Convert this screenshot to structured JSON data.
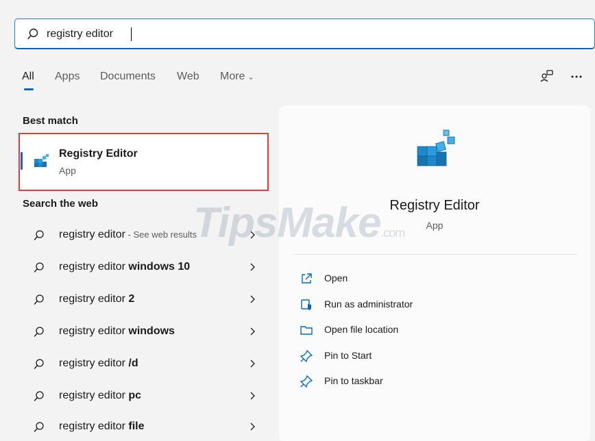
{
  "search": {
    "value": "registry editor"
  },
  "tabs": [
    {
      "label": "All"
    },
    {
      "label": "Apps"
    },
    {
      "label": "Documents"
    },
    {
      "label": "Web"
    },
    {
      "label": "More"
    }
  ],
  "top_icons": [
    "share-people-icon",
    "more-ellipsis-icon"
  ],
  "best_match": {
    "heading": "Best match",
    "title": "Registry Editor",
    "subtitle": "App"
  },
  "web": {
    "heading": "Search the web",
    "items": [
      {
        "prefix": "registry editor",
        "bold": "",
        "suffix": " - See web results"
      },
      {
        "prefix": "registry editor ",
        "bold": "windows 10",
        "suffix": ""
      },
      {
        "prefix": "registry editor ",
        "bold": "2",
        "suffix": ""
      },
      {
        "prefix": "registry editor ",
        "bold": "windows",
        "suffix": ""
      },
      {
        "prefix": "registry editor ",
        "bold": "/d",
        "suffix": ""
      },
      {
        "prefix": "registry editor ",
        "bold": "pc",
        "suffix": ""
      },
      {
        "prefix": "registry editor ",
        "bold": "file",
        "suffix": ""
      }
    ]
  },
  "detail": {
    "title": "Registry Editor",
    "subtitle": "App",
    "actions": [
      {
        "label": "Open",
        "icon": "open-external-icon"
      },
      {
        "label": "Run as administrator",
        "icon": "shield-admin-icon"
      },
      {
        "label": "Open file location",
        "icon": "folder-icon"
      },
      {
        "label": "Pin to Start",
        "icon": "pin-icon"
      },
      {
        "label": "Pin to taskbar",
        "icon": "pin-icon"
      }
    ]
  },
  "watermark": {
    "text": "TipsMake",
    "suffix": ".com"
  },
  "colors": {
    "accent": "#0067c0",
    "highlight_border": "#e43b3b",
    "registry_icon": "#1e88c9"
  }
}
